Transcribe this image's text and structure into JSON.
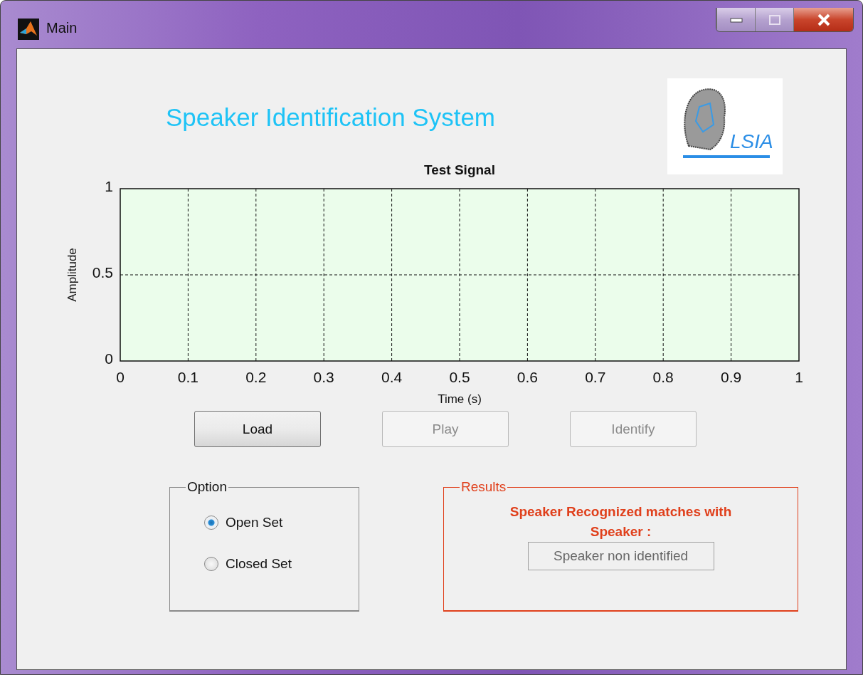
{
  "window": {
    "title": "Main"
  },
  "header": {
    "title": "Speaker Identification System",
    "logo_text": "LSIA"
  },
  "chart": {
    "chart_data": {
      "type": "line",
      "title": "Test Signal",
      "xlabel": "Time (s)",
      "ylabel": "Amplitude",
      "xlim": [
        0,
        1
      ],
      "ylim": [
        0,
        1
      ],
      "xticks": [
        0,
        0.1,
        0.2,
        0.3,
        0.4,
        0.5,
        0.6,
        0.7,
        0.8,
        0.9,
        1
      ],
      "yticks": [
        0,
        0.5,
        1
      ],
      "grid": true
    }
  },
  "buttons": [
    {
      "label": "Load",
      "disabled": false
    },
    {
      "label": "Play",
      "disabled": true
    },
    {
      "label": "Identify",
      "disabled": true
    }
  ],
  "option_group": {
    "title": "Option",
    "options": [
      {
        "label": "Open Set",
        "selected": true
      },
      {
        "label": "Closed Set",
        "selected": false
      }
    ]
  },
  "results_group": {
    "title": "Results",
    "message": "Speaker Recognized matches with Speaker :",
    "value": "Speaker non identified"
  }
}
